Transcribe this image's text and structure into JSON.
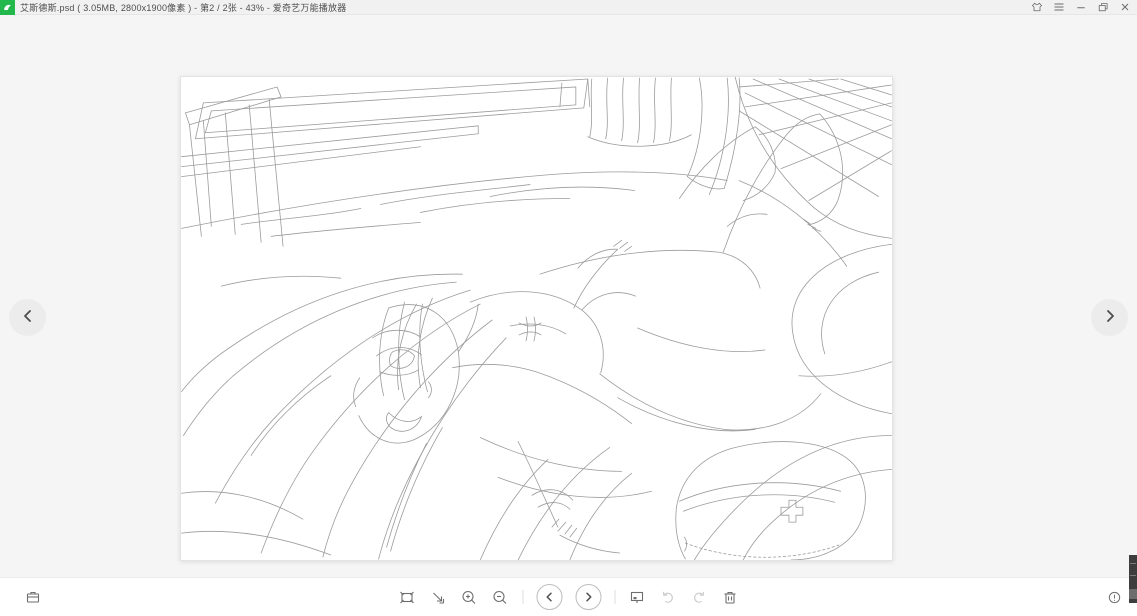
{
  "titlebar": {
    "title": "艾斯德斯.psd ( 3.05MB, 2800x1900像素 ) - 第2 / 2张 - 43% - 爱奇艺万能播放器",
    "app_logo": "player-logo",
    "logo_color": "#23b84b",
    "window_controls": [
      {
        "name": "skin-icon"
      },
      {
        "name": "menu-icon"
      },
      {
        "name": "minimize-icon"
      },
      {
        "name": "restore-icon"
      },
      {
        "name": "close-icon"
      }
    ]
  },
  "viewer": {
    "nav_prev": "chevron-left-icon",
    "nav_next": "chevron-right-icon",
    "canvas": "line-art illustration page"
  },
  "toolbar": {
    "left_icons": [
      {
        "name": "toolbox-icon"
      }
    ],
    "center_icons": [
      {
        "name": "fit-screen-icon",
        "disabled": false
      },
      {
        "name": "actual-size-icon",
        "disabled": false
      },
      {
        "name": "zoom-in-icon",
        "disabled": false
      },
      {
        "name": "zoom-out-icon",
        "disabled": false
      },
      {
        "name": "prev-image-button",
        "disabled": false
      },
      {
        "name": "next-image-button",
        "disabled": false
      },
      {
        "name": "wallpaper-icon",
        "disabled": false
      },
      {
        "name": "undo-icon",
        "disabled": true
      },
      {
        "name": "redo-icon",
        "disabled": true
      },
      {
        "name": "delete-icon",
        "disabled": false
      }
    ],
    "right_icons": [
      {
        "name": "info-icon"
      }
    ]
  },
  "colors": {
    "accent_green": "#23b84b",
    "titlebar_bg": "#f1f1f1",
    "viewer_bg": "#f5f5f5",
    "toolbar_bg": "#ffffff",
    "icon_gray": "#6e6e6e",
    "icon_disabled": "#cdcdcd",
    "sketch_line": "#9b9b9b",
    "scrollbar_thumb": "#3d3d3d"
  }
}
